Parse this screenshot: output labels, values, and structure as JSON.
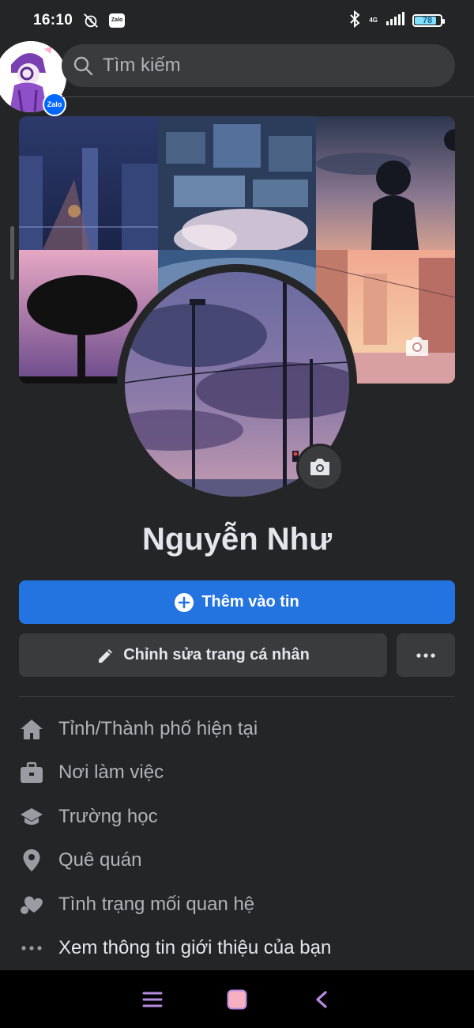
{
  "status_bar": {
    "time": "16:10",
    "app_badge": "Zalo",
    "network": "4G",
    "battery": "78",
    "battery_level": 0.78
  },
  "floating_bubble": {
    "badge": "Zalo"
  },
  "search": {
    "placeholder": "Tìm kiếm"
  },
  "profile": {
    "name": "Nguyễn Như"
  },
  "actions": {
    "add_story": "Thêm vào tin",
    "edit_profile": "Chỉnh sửa trang cá nhân"
  },
  "details": [
    {
      "icon": "home-icon",
      "label": "Tỉnh/Thành phố hiện tại"
    },
    {
      "icon": "briefcase-icon",
      "label": "Nơi làm việc"
    },
    {
      "icon": "graduation-cap-icon",
      "label": "Trường học"
    },
    {
      "icon": "location-pin-icon",
      "label": "Quê quán"
    },
    {
      "icon": "heart-icon",
      "label": "Tình trạng mối quan hệ"
    },
    {
      "icon": "more-dots-icon",
      "label": "Xem thông tin giới thiệu của bạn"
    }
  ],
  "colors": {
    "background": "#242526",
    "primary_button": "#2374e1",
    "secondary_button": "#3a3b3c",
    "text": "#e4e6eb",
    "muted_text": "#b0b3b8"
  }
}
